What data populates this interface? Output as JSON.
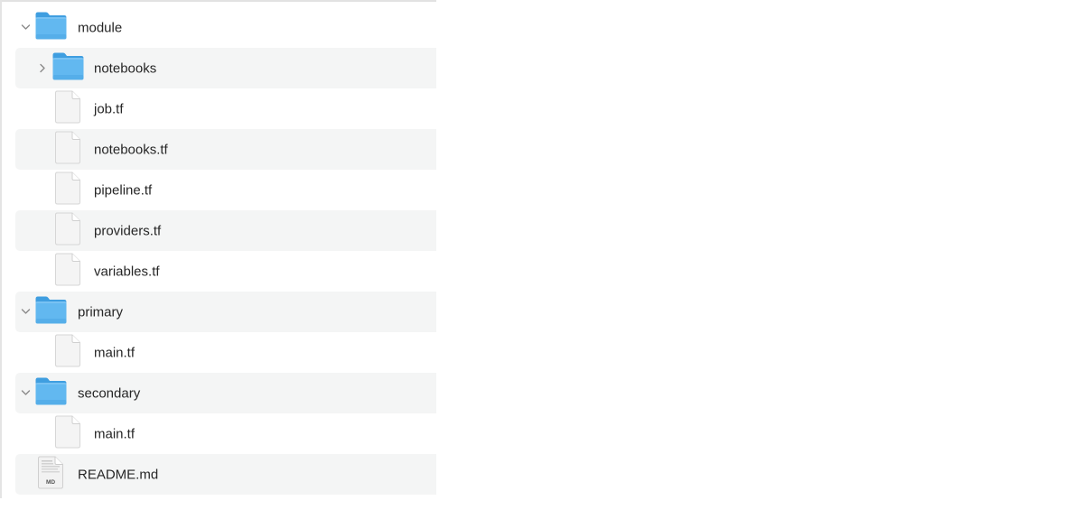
{
  "tree": [
    {
      "type": "folder",
      "name": "module",
      "level": 0,
      "expanded": true,
      "icon": "folder-icon",
      "chevron": "chevron-down-icon"
    },
    {
      "type": "folder",
      "name": "notebooks",
      "level": 1,
      "expanded": false,
      "icon": "folder-icon",
      "chevron": "chevron-right-icon"
    },
    {
      "type": "file",
      "name": "job.tf",
      "level": 1,
      "icon": "document-icon"
    },
    {
      "type": "file",
      "name": "notebooks.tf",
      "level": 1,
      "icon": "document-icon"
    },
    {
      "type": "file",
      "name": "pipeline.tf",
      "level": 1,
      "icon": "document-icon"
    },
    {
      "type": "file",
      "name": "providers.tf",
      "level": 1,
      "icon": "document-icon"
    },
    {
      "type": "file",
      "name": "variables.tf",
      "level": 1,
      "icon": "document-icon"
    },
    {
      "type": "folder",
      "name": "primary",
      "level": 0,
      "expanded": true,
      "icon": "folder-icon",
      "chevron": "chevron-down-icon"
    },
    {
      "type": "file",
      "name": "main.tf",
      "level": 1,
      "icon": "document-icon"
    },
    {
      "type": "folder",
      "name": "secondary",
      "level": 0,
      "expanded": true,
      "icon": "folder-icon",
      "chevron": "chevron-down-icon"
    },
    {
      "type": "file",
      "name": "main.tf",
      "level": 1,
      "icon": "document-icon"
    },
    {
      "type": "file",
      "name": "README.md",
      "level": 0,
      "icon": "markdown-file-icon",
      "badge": "MD"
    }
  ],
  "colors": {
    "folder": "#5fb6ee",
    "folder_dark": "#3f9ee0",
    "stripe": "#f4f5f5"
  }
}
